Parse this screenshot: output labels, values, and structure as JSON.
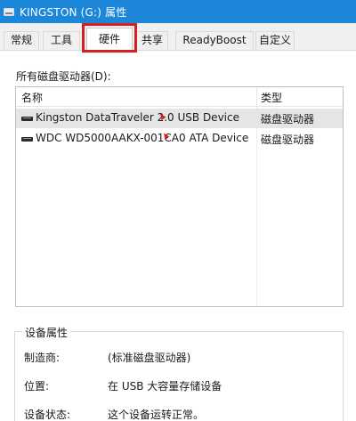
{
  "window": {
    "title": "KINGSTON (G:) 属性"
  },
  "tabs": [
    {
      "label": "常规"
    },
    {
      "label": "工具"
    },
    {
      "label": "硬件"
    },
    {
      "label": "共享"
    },
    {
      "label": "ReadyBoost"
    },
    {
      "label": "自定义"
    }
  ],
  "active_tab": "硬件",
  "drives": {
    "label": "所有磁盘驱动器(D):",
    "columns": {
      "name": "名称",
      "type": "类型"
    },
    "rows": [
      {
        "name": "Kingston DataTraveler 2.0 USB Device",
        "type": "磁盘驱动器",
        "selected": true
      },
      {
        "name": "WDC WD5000AAKX-001CA0 ATA Device",
        "type": "磁盘驱动器",
        "selected": false
      }
    ]
  },
  "device_properties": {
    "title": "设备属性",
    "manufacturer_label": "制造商:",
    "manufacturer_value": "(标准磁盘驱动器)",
    "location_label": "位置:",
    "location_value": "在 USB 大容量存储设备",
    "status_label": "设备状态:",
    "status_value": "这个设备运转正常。"
  },
  "colors": {
    "titlebar": "#1c86d8",
    "highlight": "#d42020",
    "selected_row": "#e5e5e5"
  }
}
